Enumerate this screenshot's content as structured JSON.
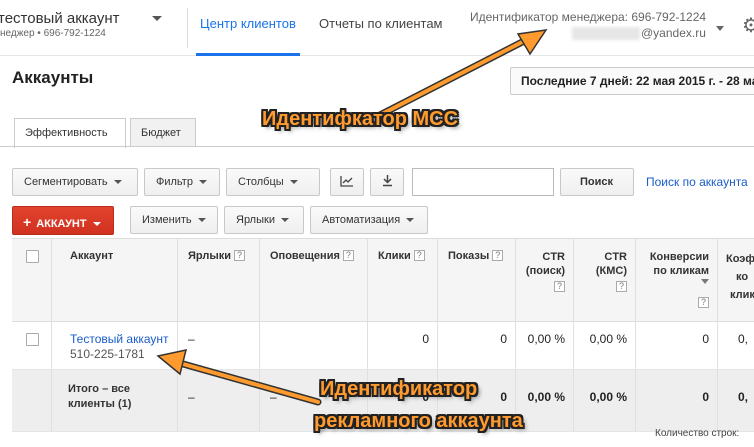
{
  "header": {
    "account_name": "тестовый аккаунт",
    "account_sub": "неджер • 696-792-1224",
    "nav_clients": "Центр клиентов",
    "nav_reports": "Отчеты по клиентам",
    "manager_id": "Идентификатор менеджера: 696-792-1224",
    "manager_email": "@yandex.ru",
    "settings_icon": "gear-icon"
  },
  "page": {
    "title": "Аккаунты",
    "date_range": "Последние 7 дней: 22 мая 2015 г. - 28 ма"
  },
  "subtabs": {
    "performance": "Эффективность",
    "budget": "Бюджет"
  },
  "toolbar1": {
    "segment": "Сегментировать",
    "filter": "Фильтр",
    "columns": "Столбцы",
    "chart_icon": "📈",
    "download_icon": "⬇",
    "search_placeholder": "",
    "search_button": "Поиск",
    "search_accounts": "Поиск по аккаунта"
  },
  "toolbar2": {
    "add_plus": "+",
    "add_account": "АККАУНТ",
    "edit": "Изменить",
    "labels": "Ярлыки",
    "automation": "Автоматизация"
  },
  "table": {
    "headers": {
      "account": "Аккаунт",
      "labels": "Ярлыки",
      "alerts": "Оповещения",
      "clicks": "Клики",
      "impressions": "Показы",
      "ctr_search_1": "CTR",
      "ctr_search_2": "(поиск)",
      "ctr_kms_1": "CTR",
      "ctr_kms_2": "(КМС)",
      "conv_1": "Конверсии",
      "conv_2": "по кликам",
      "coef_1": "Коэф",
      "coef_2": "ко",
      "coef_3": "клик",
      "help": "?"
    },
    "rows": [
      {
        "account_name": "Тестовый аккаунт",
        "account_id": "510-225-1781",
        "labels": "–",
        "clicks": "0",
        "impressions": "0",
        "ctr_search": "0,00 %",
        "ctr_kms": "0,00 %",
        "conversions": "0",
        "coef": "0,"
      }
    ],
    "total": {
      "label_1": "Итого – все",
      "label_2": "клиенты (1)",
      "labels": "–",
      "alerts": "–",
      "clicks": "0",
      "impressions": "0",
      "ctr_search": "0,00 %",
      "ctr_kms": "0,00 %",
      "conversions": "0",
      "coef": "0,"
    }
  },
  "footer": {
    "rows_count_label": "Количество строк:"
  },
  "annotations": {
    "mcc": "Идентифкатор MCC",
    "account_line1": "Идентификатор",
    "account_line2": "рекламного аккаунта",
    "color": "#ff9a2e"
  }
}
